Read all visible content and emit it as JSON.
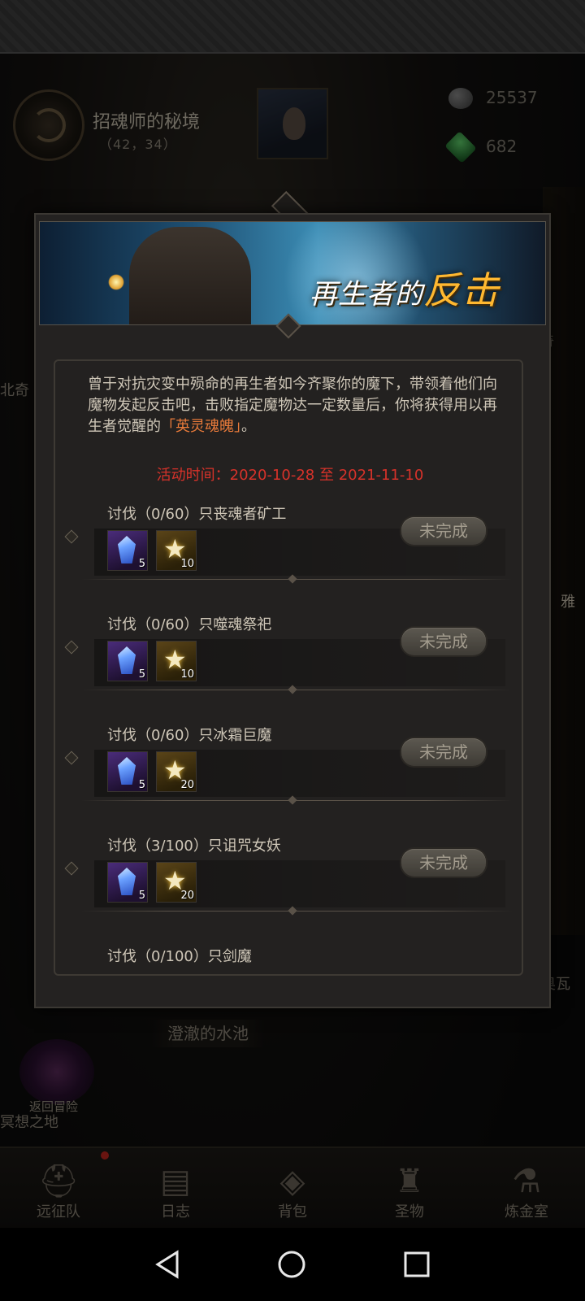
{
  "header": {
    "location_name": "招魂师的秘境",
    "location_coords": "（42，34）",
    "resources": [
      {
        "name": "stone",
        "value": "25537"
      },
      {
        "name": "gem",
        "value": "682"
      }
    ]
  },
  "background": {
    "left_label": "北奇",
    "right_label_a": "奇",
    "right_label_b": "雅",
    "right_label_c": "奥瓦",
    "pond_label": "澄澈的水池",
    "return_label": "返回冒险",
    "meditation_label": "冥想之地"
  },
  "event": {
    "banner_title_a": "再生者的",
    "banner_title_b": "反击",
    "description_main": "曾于对抗灾变中殒命的再生者如今齐聚你的魔下，带领着他们向魔物发起反击吧，击败指定魔物达一定数量后，你将获得用以再生者觉醒的",
    "description_highlight": "「英灵魂魄」",
    "description_end": "。",
    "time": "活动时间：2020-10-28 至 2021-11-10",
    "quests": [
      {
        "title": "讨伐（0/60）只丧魂者矿工",
        "crystal": "5",
        "star": "10",
        "status": "未完成"
      },
      {
        "title": "讨伐（0/60）只噬魂祭祀",
        "crystal": "5",
        "star": "10",
        "status": "未完成"
      },
      {
        "title": "讨伐（0/60）只冰霜巨魔",
        "crystal": "5",
        "star": "20",
        "status": "未完成"
      },
      {
        "title": "讨伐（3/100）只诅咒女妖",
        "crystal": "5",
        "star": "20",
        "status": "未完成"
      },
      {
        "title": "讨伐（0/100）只剑魔"
      }
    ]
  },
  "bottom_nav": {
    "items": [
      {
        "label": "远征队",
        "icon": "viking-helmet-icon"
      },
      {
        "label": "日志",
        "icon": "journal-icon"
      },
      {
        "label": "背包",
        "icon": "backpack-icon"
      },
      {
        "label": "圣物",
        "icon": "relic-torch-icon"
      },
      {
        "label": "炼金室",
        "icon": "alchemy-icon"
      }
    ]
  },
  "colors": {
    "accent_red": "#d6322a",
    "highlight_orange": "#e87a3a",
    "banner_gold": "#ffb830"
  }
}
